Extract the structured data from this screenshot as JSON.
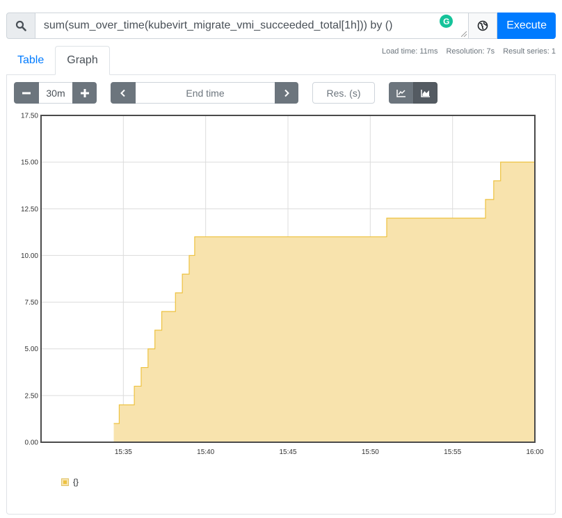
{
  "query": {
    "expression": "sum(sum_over_time(kubevirt_migrate_vmi_succeeded_total[1h])) by ()",
    "execute_label": "Execute"
  },
  "tabs": [
    {
      "label": "Table",
      "active": false
    },
    {
      "label": "Graph",
      "active": true
    }
  ],
  "stats": {
    "load_time": "Load time: 11ms",
    "resolution": "Resolution: 7s",
    "result_series": "Result series: 1"
  },
  "controls": {
    "range": "30m",
    "end_time_placeholder": "End time",
    "resolution_placeholder": "Res. (s)"
  },
  "legend": {
    "series_label": "{}"
  },
  "icons": {
    "search": "search-icon",
    "globe": "globe-icon",
    "minus": "minus-icon",
    "plus": "plus-icon",
    "prev": "chevron-left-icon",
    "next": "chevron-right-icon",
    "line_chart": "line-chart-icon",
    "area_chart": "area-chart-icon"
  },
  "colors": {
    "execute": "#007bff",
    "series_fill": "#f8e3ad",
    "series_line": "#edc240"
  },
  "chart_data": {
    "type": "area",
    "stacked": true,
    "grid": true,
    "legend_position": "bottom-left",
    "xlim": [
      "15:30",
      "16:00"
    ],
    "ylim": [
      0,
      17.5
    ],
    "x_ticks": [
      "15:35",
      "15:40",
      "15:45",
      "15:50",
      "15:55",
      "16:00"
    ],
    "y_ticks": [
      "0.00",
      "2.50",
      "5.00",
      "7.50",
      "10.00",
      "12.50",
      "15.00",
      "17.50"
    ],
    "series": [
      {
        "name": "{}",
        "step": true,
        "x": [
          "15:34:25",
          "15:34:45",
          "15:35:40",
          "15:36:05",
          "15:36:30",
          "15:36:55",
          "15:37:20",
          "15:38:10",
          "15:38:35",
          "15:39:00",
          "15:39:20",
          "15:51:00",
          "15:57:00",
          "15:57:30",
          "15:57:55",
          "16:00:00"
        ],
        "values": [
          1,
          2,
          3,
          4,
          5,
          6,
          7,
          8,
          9,
          10,
          11,
          12,
          13,
          14,
          15,
          15
        ]
      }
    ]
  }
}
